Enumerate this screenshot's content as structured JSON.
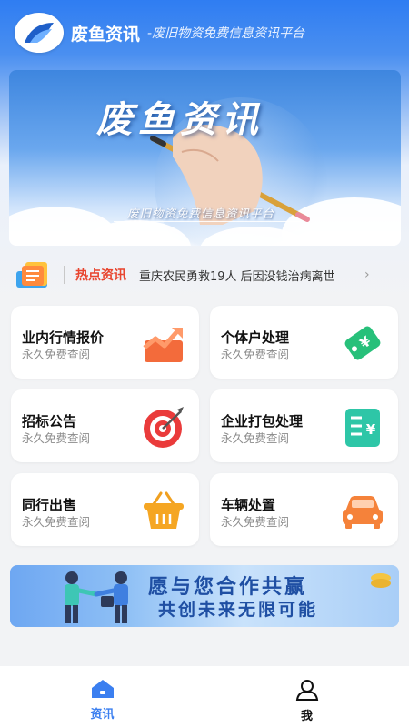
{
  "header": {
    "app_name": "废鱼资讯",
    "tagline": "-废旧物资免费信息资讯平台"
  },
  "banner": {
    "title": "废鱼资讯",
    "subtitle": "废旧物资免费信息资讯平台"
  },
  "news": {
    "label": "热点资讯",
    "headline": "重庆农民勇救19人  后因没钱治病离世",
    "arrow": "›"
  },
  "cards": [
    {
      "title": "业内行情报价",
      "subtitle": "永久免费查阅",
      "icon": "trend-chart-icon"
    },
    {
      "title": "个体户处理",
      "subtitle": "永久免费查阅",
      "icon": "yuan-tag-icon"
    },
    {
      "title": "招标公告",
      "subtitle": "永久免费查阅",
      "icon": "target-icon"
    },
    {
      "title": "企业打包处理",
      "subtitle": "永久免费查阅",
      "icon": "invoice-icon"
    },
    {
      "title": "同行出售",
      "subtitle": "永久免费查阅",
      "icon": "basket-icon"
    },
    {
      "title": "车辆处置",
      "subtitle": "永久免费查阅",
      "icon": "car-icon"
    }
  ],
  "promo": {
    "line1": "愿与您合作共赢",
    "line2": "共创未来无限可能"
  },
  "tabbar": {
    "tabs": [
      {
        "label": "资讯",
        "icon": "home-icon",
        "active": true
      },
      {
        "label": "我",
        "icon": "user-icon",
        "active": false
      }
    ]
  },
  "colors": {
    "accent": "#2f7df2",
    "hot": "#e8452f",
    "promo_text": "#1f4fa3"
  }
}
